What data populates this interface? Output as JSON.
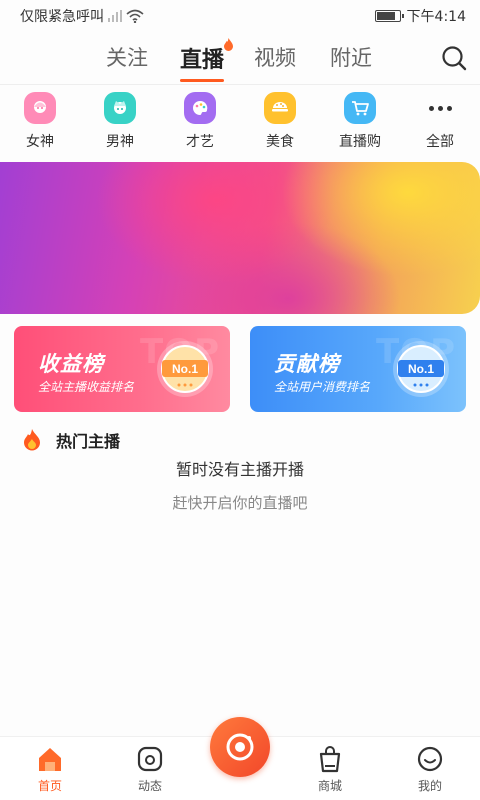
{
  "status_bar": {
    "carrier": "仅限紧急呼叫",
    "time": "下午4:14"
  },
  "top_tabs": [
    {
      "label": "关注",
      "active": false
    },
    {
      "label": "直播",
      "active": true
    },
    {
      "label": "视频",
      "active": false
    },
    {
      "label": "附近",
      "active": false
    }
  ],
  "categories": [
    {
      "label": "女神",
      "icon": "goddess-icon",
      "color": "#ff88b8"
    },
    {
      "label": "男神",
      "icon": "god-icon",
      "color": "#3ad3c8"
    },
    {
      "label": "才艺",
      "icon": "palette-icon",
      "color": "#a06bf0"
    },
    {
      "label": "美食",
      "icon": "food-icon",
      "color": "#ffc12e"
    },
    {
      "label": "直播购",
      "icon": "cart-icon",
      "color": "#42b8f5"
    },
    {
      "label": "全部",
      "icon": "more-dots-icon",
      "color": "#333333"
    }
  ],
  "rank_cards": [
    {
      "title": "收益榜",
      "subtitle": "全站主播收益排名",
      "badge": "No.1",
      "watermark": "TOP"
    },
    {
      "title": "贡献榜",
      "subtitle": "全站用户消费排名",
      "badge": "No.1",
      "watermark": "TOP"
    }
  ],
  "hot": {
    "title": "热门主播",
    "empty_primary": "暂时没有主播开播",
    "empty_secondary": "赶快开启你的直播吧"
  },
  "bottom_nav": [
    {
      "label": "首页",
      "icon": "home-icon",
      "active": true
    },
    {
      "label": "动态",
      "icon": "moments-icon",
      "active": false
    },
    {
      "label": "",
      "icon": "camera-icon",
      "active": false
    },
    {
      "label": "商城",
      "icon": "shop-bag-icon",
      "active": false
    },
    {
      "label": "我的",
      "icon": "profile-icon",
      "active": false
    }
  ],
  "colors": {
    "accent": "#ff5a1f",
    "income_card": "#ff5b7f",
    "contribution_card": "#4a9bf9"
  }
}
